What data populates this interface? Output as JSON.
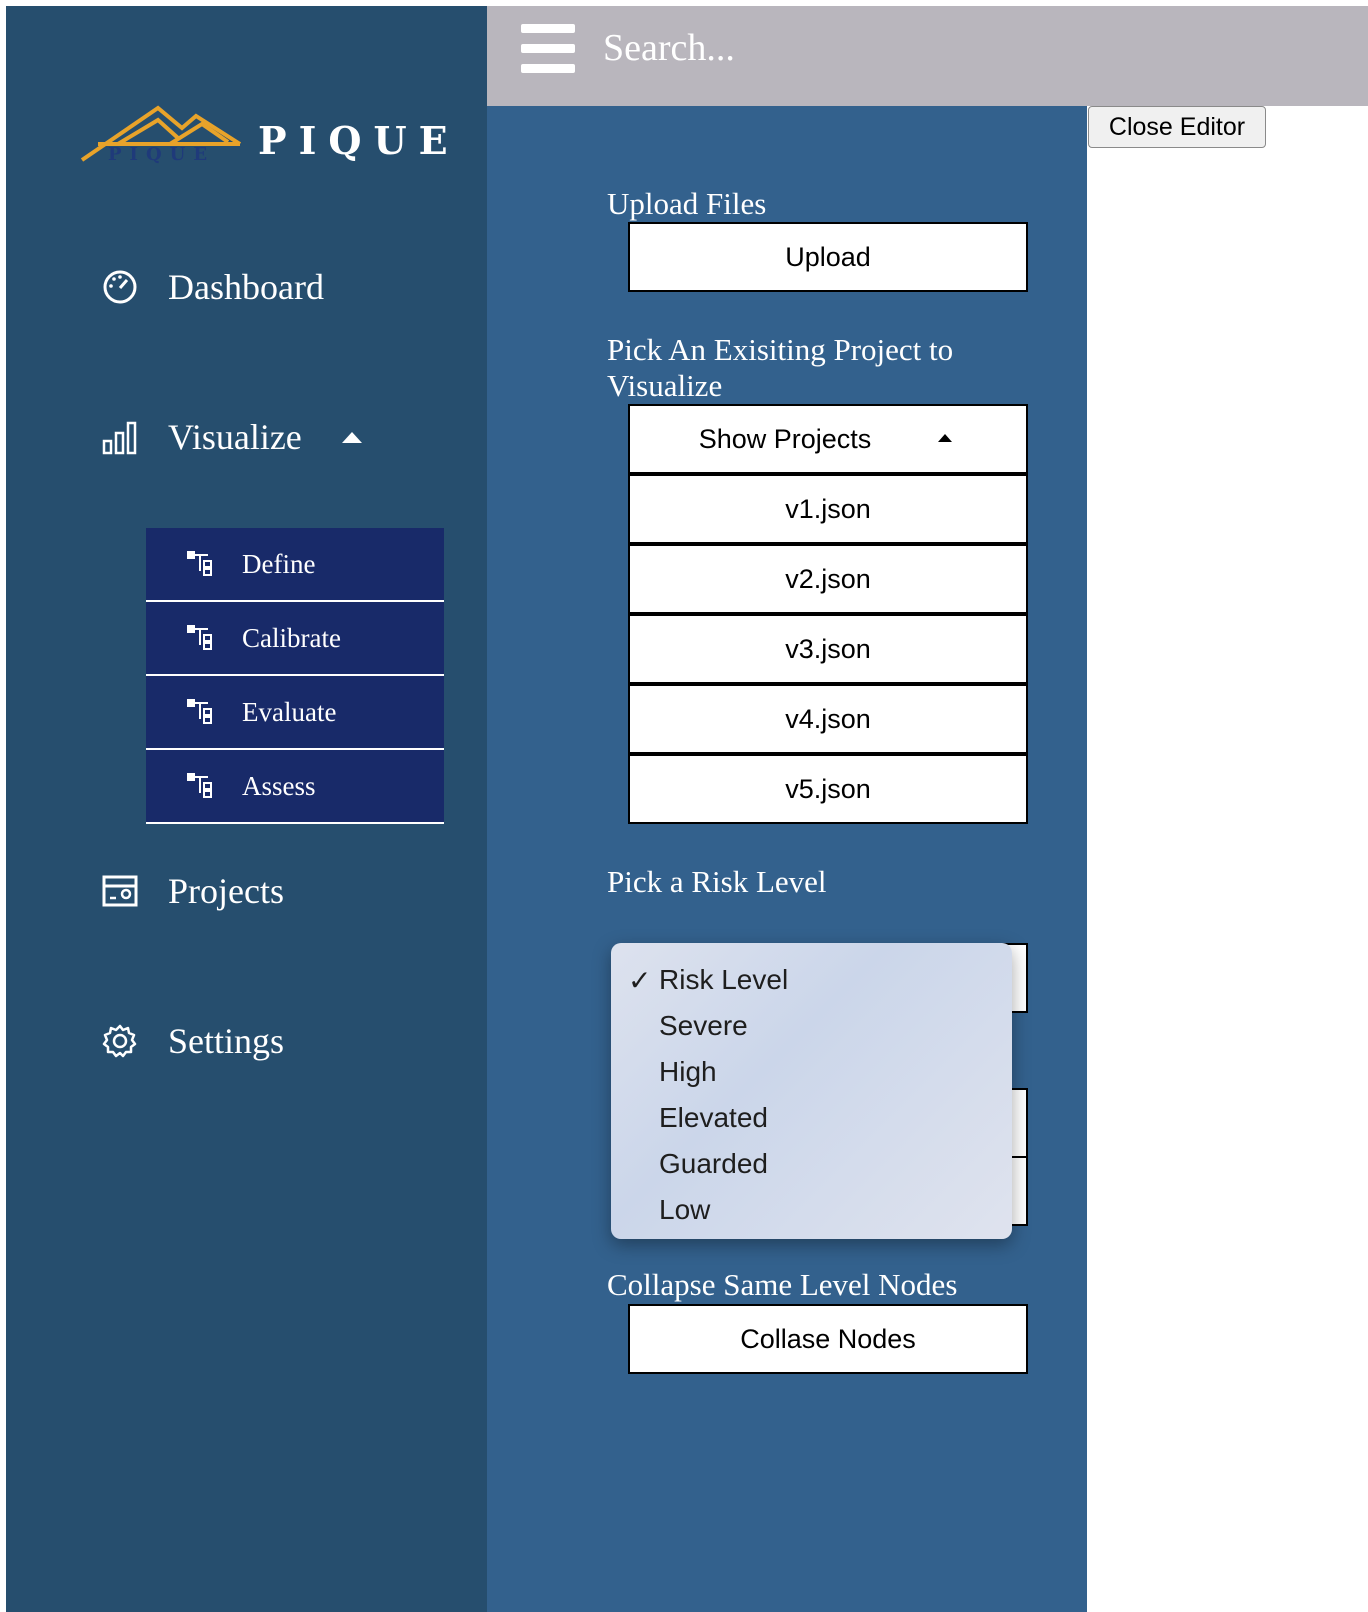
{
  "brand": {
    "name": "PIQUE",
    "logo_text": "PIQUE"
  },
  "topbar": {
    "search_placeholder": "Search..."
  },
  "editor": {
    "close_label": "Close Editor"
  },
  "sidebar": {
    "items": [
      {
        "label": "Dashboard",
        "icon": "dashboard-gauge-icon"
      },
      {
        "label": "Visualize",
        "icon": "bar-chart-icon"
      },
      {
        "label": "Projects",
        "icon": "projects-box-icon"
      },
      {
        "label": "Settings",
        "icon": "gear-icon"
      }
    ],
    "subitems": [
      {
        "label": "Define",
        "icon": "tree-icon"
      },
      {
        "label": "Calibrate",
        "icon": "tree-icon"
      },
      {
        "label": "Evaluate",
        "icon": "tree-icon"
      },
      {
        "label": "Assess",
        "icon": "tree-icon"
      }
    ]
  },
  "panel": {
    "upload_heading": "Upload Files",
    "upload_button": "Upload",
    "project_heading": "Pick An Exisiting Project to Visualize",
    "show_projects": "Show Projects",
    "projects": [
      "v1.json",
      "v2.json",
      "v3.json",
      "v4.json",
      "v5.json"
    ],
    "risk_heading": "Pick a Risk Level",
    "risk_options": [
      "Risk Level",
      "Severe",
      "High",
      "Elevated",
      "Guarded",
      "Low"
    ],
    "risk_selected": "Risk Level",
    "collapse_heading": "Collapse Same Level Nodes",
    "collapse_button": "Collase Nodes"
  },
  "colors": {
    "sidebar": "#264e6e",
    "main": "#33618d",
    "submenu": "#182a69",
    "topbar": "#b9b6bd",
    "logo_gold": "#e8a32a",
    "logo_navy": "#1f3a7a"
  }
}
